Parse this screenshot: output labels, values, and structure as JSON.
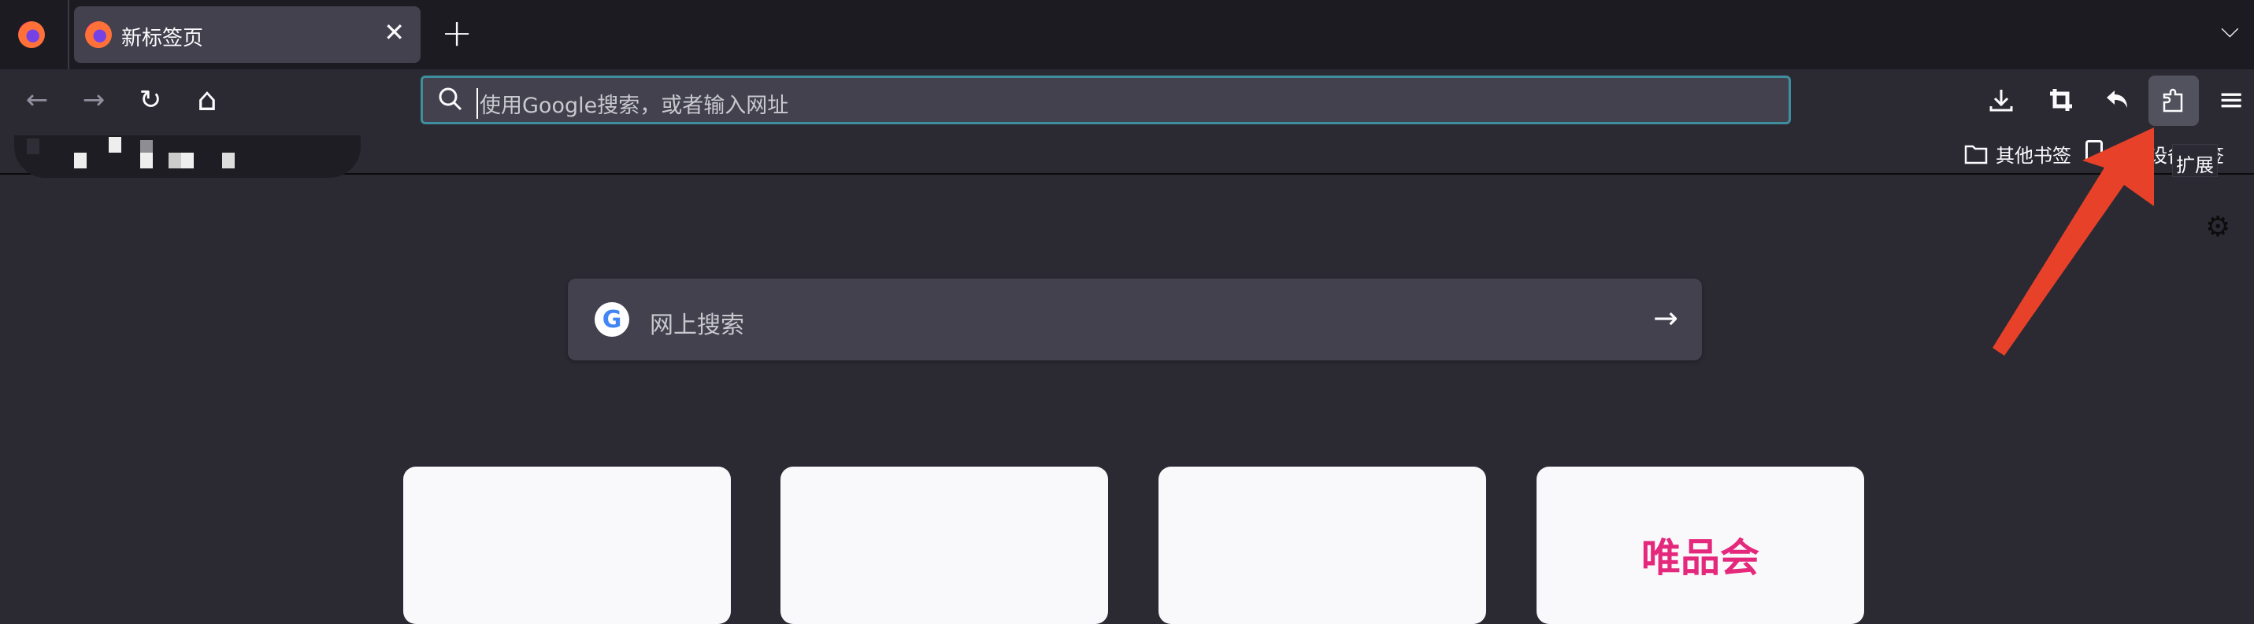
{
  "tabs": [
    {
      "title": "新标签页",
      "close": "✕"
    }
  ],
  "tabbar": {
    "new_tab": "+",
    "list_all": "⌵"
  },
  "nav": {
    "back": "←",
    "forward": "→",
    "reload": "↻",
    "home": "⌂",
    "menu": "≡"
  },
  "urlbar": {
    "placeholder": "使用Google搜索，或者输入网址"
  },
  "bookmarks": {
    "other": "其他书签",
    "mobile": "移动设备书签"
  },
  "tooltip": "扩展",
  "search": {
    "placeholder": "网上搜索",
    "g": "G",
    "go": "→"
  },
  "tiles": [
    {
      "label": ""
    },
    {
      "label": ""
    },
    {
      "label": ""
    },
    {
      "label": "唯品会"
    }
  ],
  "colors": {
    "accent": "#3e8e9e",
    "annotation_arrow": "#e8412a"
  }
}
